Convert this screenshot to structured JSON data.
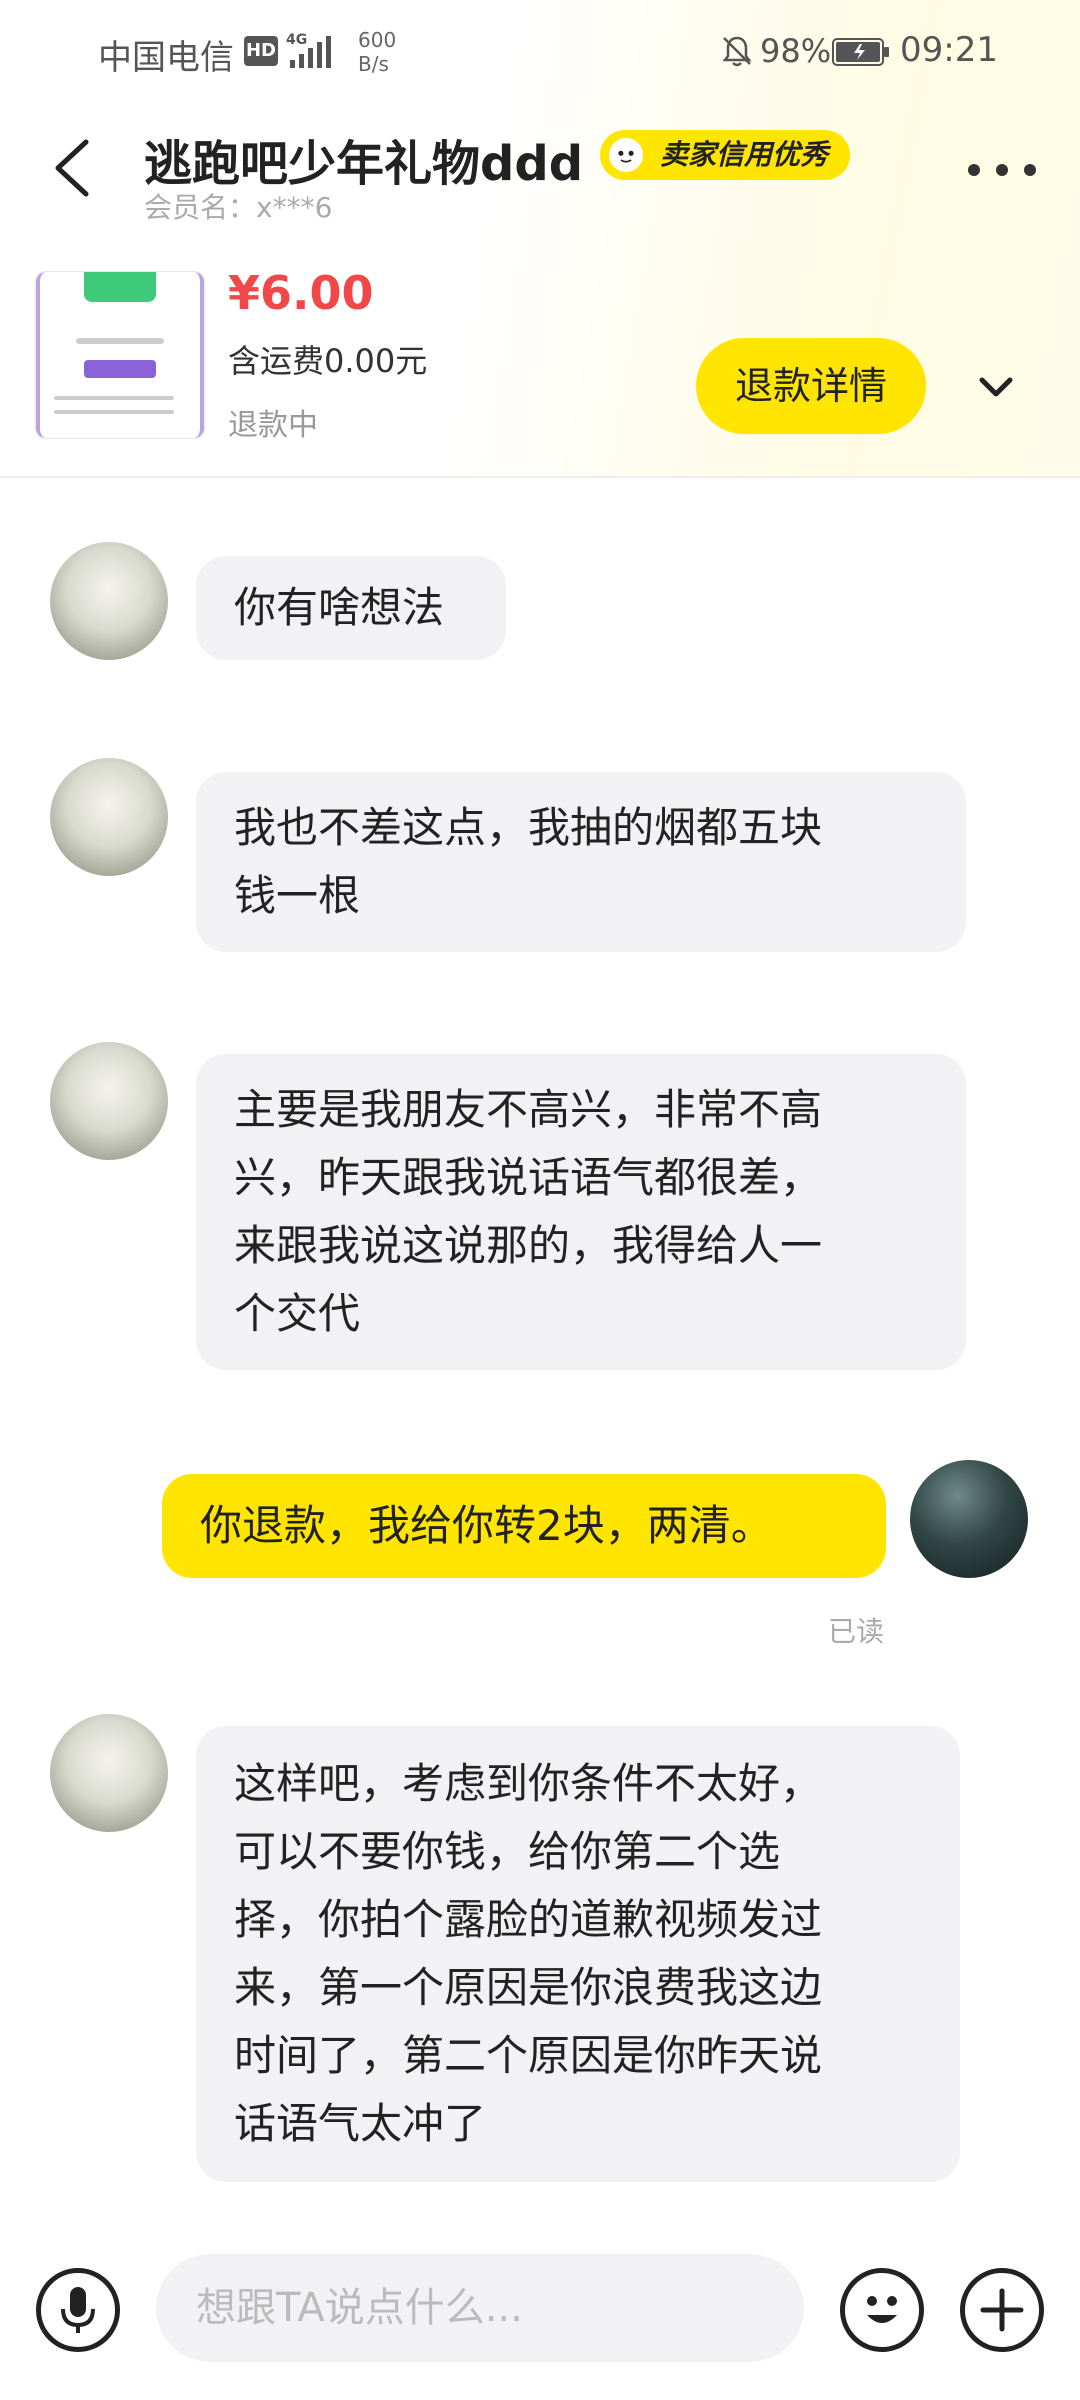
{
  "status_bar": {
    "carrier": "中国电信",
    "hd": "HD",
    "speed_value": "600",
    "speed_unit": "B/s",
    "battery": "98%",
    "time": "09:21"
  },
  "header": {
    "shop_name": "逃跑吧少年礼物ddd",
    "credit_badge": "卖家信用优秀",
    "member": "会员名：x***6"
  },
  "product": {
    "price": "¥6.00",
    "shipping": "含运费0.00元",
    "status": "退款中",
    "refund_button": "退款详情"
  },
  "messages": [
    {
      "side": "in",
      "lines": [
        "你有啥想法"
      ]
    },
    {
      "side": "in",
      "lines": [
        "我也不差这点，我抽的烟都五块",
        "钱一根"
      ]
    },
    {
      "side": "in",
      "lines": [
        "主要是我朋友不高兴，非常不高",
        "兴，昨天跟我说话语气都很差，",
        "来跟我说这说那的，我得给人一",
        "个交代"
      ]
    },
    {
      "side": "out",
      "lines": [
        "你退款，我给你转2块，两清。"
      ],
      "receipt": "已读"
    },
    {
      "side": "in",
      "lines": [
        "这样吧，考虑到你条件不太好，",
        "可以不要你钱，给你第二个选",
        "择，你拍个露脸的道歉视频发过",
        "来，第一个原因是你浪费我这边",
        "时间了，第二个原因是你昨天说",
        "话语气太冲了"
      ]
    }
  ],
  "input": {
    "placeholder": "想跟TA说点什么..."
  },
  "icons": {
    "back": "back-arrow-icon",
    "more": "more-dots-icon",
    "chevron": "chevron-down-icon",
    "voice": "microphone-icon",
    "emoji": "emoji-icon",
    "plus": "plus-icon"
  },
  "colors": {
    "accent": "#ffe500",
    "price": "#f04848",
    "incoming_bubble": "#f2f2f4"
  }
}
